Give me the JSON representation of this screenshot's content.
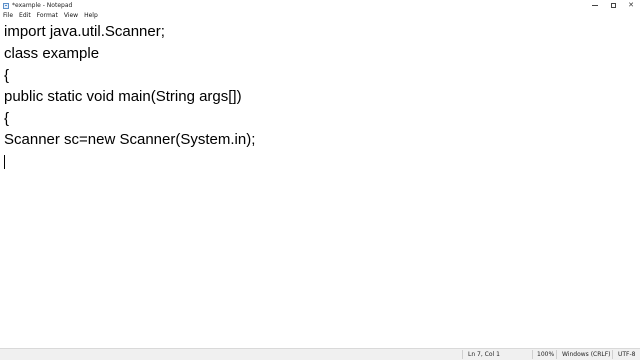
{
  "window": {
    "title": "*example - Notepad",
    "icon": "notepad-icon",
    "controls": {
      "minimize": "minimize-icon",
      "maximize": "maximize-icon",
      "close": "close-icon",
      "close_glyph": "✕"
    }
  },
  "menu": {
    "items": [
      "File",
      "Edit",
      "Format",
      "View",
      "Help"
    ]
  },
  "editor": {
    "lines": [
      "import java.util.Scanner;",
      "class example",
      "{",
      "public static void main(String args[])",
      "{",
      "Scanner sc=new Scanner(System.in);",
      ""
    ]
  },
  "status": {
    "position": "Ln 7, Col 1",
    "zoom": "100%",
    "line_ending": "Windows (CRLF)",
    "encoding": "UTF-8"
  }
}
